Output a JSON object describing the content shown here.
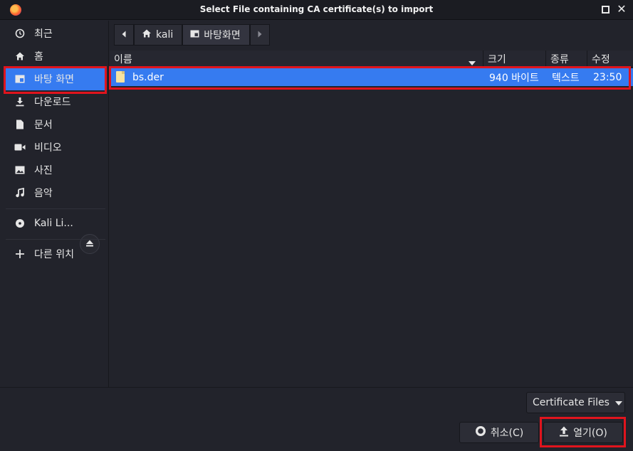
{
  "window": {
    "title": "Select File containing CA certificate(s) to import",
    "app_icon": "firefox-icon"
  },
  "sidebar": {
    "items": [
      {
        "label": "최근",
        "icon": "clock-icon"
      },
      {
        "label": "홈",
        "icon": "home-icon"
      },
      {
        "label": "바탕 화면",
        "icon": "desktop-icon",
        "selected": true
      },
      {
        "label": "다운로드",
        "icon": "download-icon"
      },
      {
        "label": "문서",
        "icon": "document-icon"
      },
      {
        "label": "비디오",
        "icon": "video-icon"
      },
      {
        "label": "사진",
        "icon": "picture-icon"
      },
      {
        "label": "음악",
        "icon": "music-icon"
      }
    ],
    "volume": {
      "label": "Kali Li...",
      "icon": "disc-icon",
      "eject_icon": "eject-icon"
    },
    "other_locations": {
      "label": "다른 위치",
      "icon": "plus-icon"
    }
  },
  "pathbar": {
    "crumbs": [
      {
        "label": "kali",
        "icon": "home-icon"
      },
      {
        "label": "바탕화면",
        "icon": "desktop-icon"
      }
    ]
  },
  "filelist": {
    "columns": [
      "이름",
      "크기",
      "종류",
      "수정"
    ],
    "rows": [
      {
        "name": "bs.der",
        "size": "940 바이트",
        "type": "텍스트",
        "modified": "23:50",
        "selected": true
      }
    ]
  },
  "footer": {
    "filter_label": "Certificate Files",
    "cancel_label": "취소(C)",
    "open_label": "열기(O)"
  },
  "colors": {
    "accent": "#367bf0",
    "highlight": "#e0141d",
    "background": "#22232b"
  }
}
